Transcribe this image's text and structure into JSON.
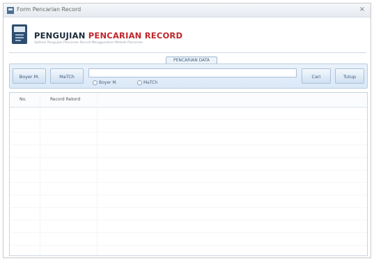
{
  "window": {
    "title": "Form Pencarian Record",
    "close_glyph": "×"
  },
  "header": {
    "title_dark": "PENGUJIAN",
    "title_red": "PENCARIAN RECORD",
    "subtitle": "Aplikasi Pengujian Pencarian Record Menggunakan Metode Pencarian"
  },
  "section": {
    "title": "PENCARIAN DATA"
  },
  "toolbar": {
    "buttons": [
      {
        "label": "Boyer M."
      },
      {
        "label": "MaTCh"
      },
      {
        "label": "Cari"
      },
      {
        "label": "Tutup"
      }
    ],
    "search": {
      "value": "",
      "placeholder": ""
    },
    "radios": [
      {
        "label": "Boyer M."
      },
      {
        "label": "MaTCh"
      }
    ]
  },
  "table": {
    "columns": [
      "No.",
      "Record Rekord"
    ],
    "rows": []
  },
  "colors": {
    "accent_red": "#c0262b",
    "title_dark": "#1a2a3a",
    "toolbar_bg": "#dbe8f6"
  }
}
